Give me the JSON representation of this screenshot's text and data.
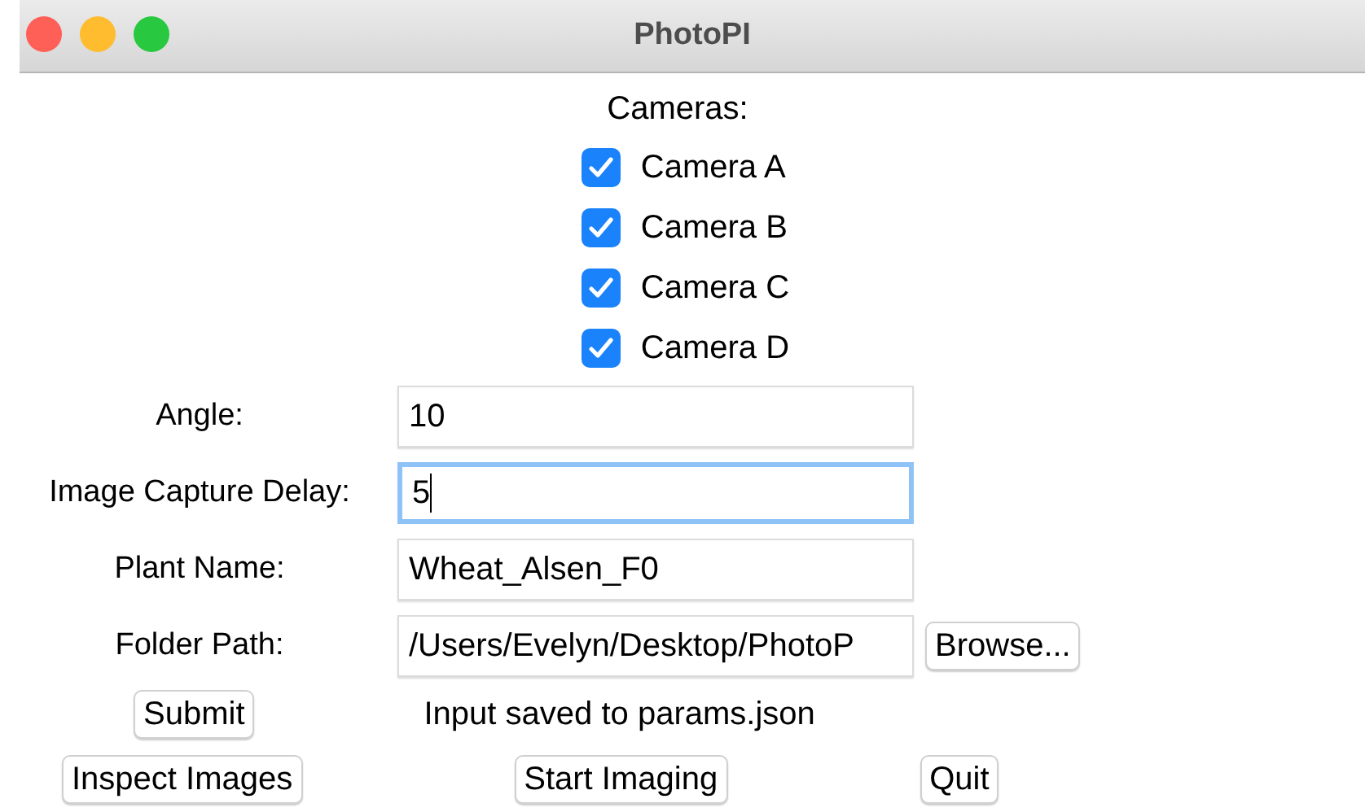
{
  "window": {
    "title": "PhotoPI"
  },
  "cameras": {
    "label": "Cameras:",
    "items": [
      {
        "label": "Camera A",
        "checked": true
      },
      {
        "label": "Camera B",
        "checked": true
      },
      {
        "label": "Camera C",
        "checked": true
      },
      {
        "label": "Camera D",
        "checked": true
      }
    ]
  },
  "fields": [
    {
      "label": "Angle:",
      "value": "10",
      "focused": false
    },
    {
      "label": "Image Capture Delay:",
      "value": "5",
      "focused": true
    },
    {
      "label": "Plant Name:",
      "value": "Wheat_Alsen_F0",
      "focused": false
    },
    {
      "label": "Folder Path:",
      "value": "/Users/Evelyn/Desktop/PhotoP",
      "focused": false,
      "button": "Browse..."
    }
  ],
  "submit": {
    "button": "Submit",
    "status": "Input saved to params.json"
  },
  "actions": [
    "Inspect Images",
    "Start Imaging",
    "Quit"
  ]
}
